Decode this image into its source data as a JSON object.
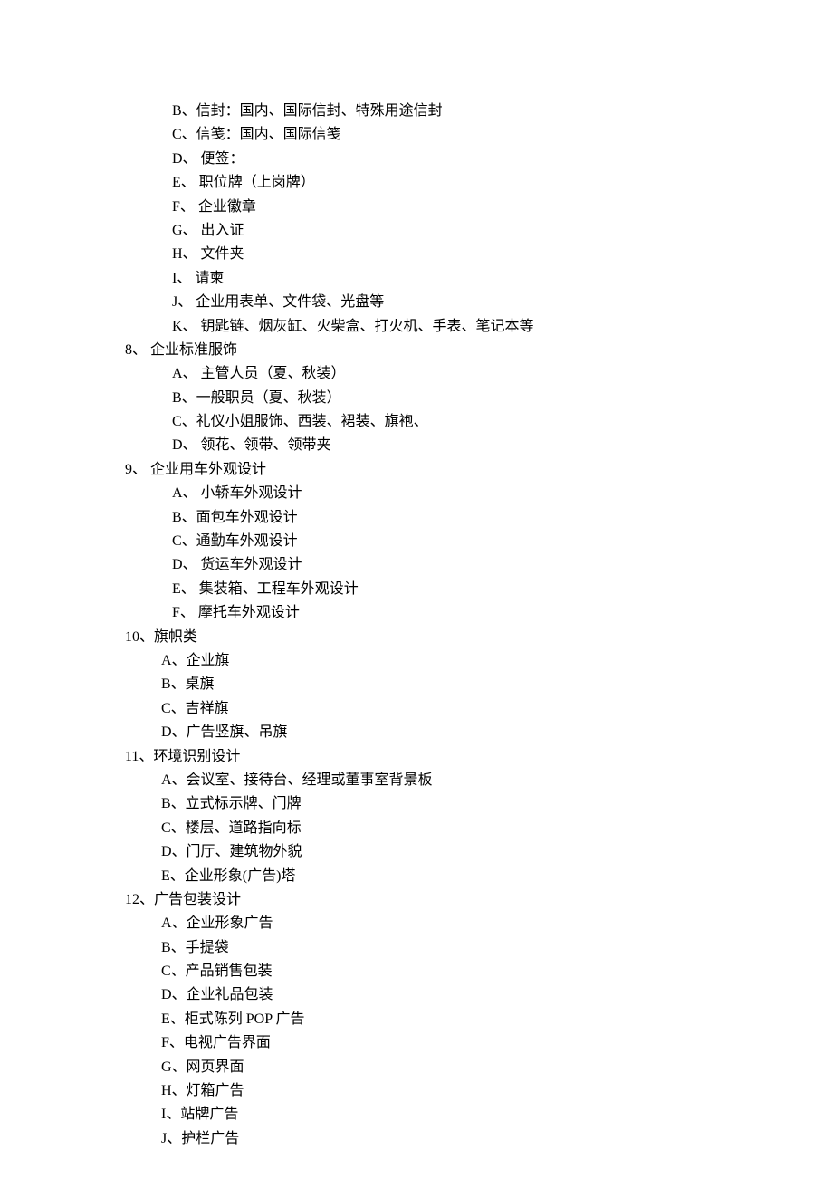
{
  "items": [
    {
      "class": "sub-item",
      "text": "B、信封：国内、国际信封、特殊用途信封"
    },
    {
      "class": "sub-item",
      "text": "C、信笺：国内、国际信笺"
    },
    {
      "class": "sub-item",
      "text": "D、 便签："
    },
    {
      "class": "sub-item",
      "text": "E、 职位牌（上岗牌）"
    },
    {
      "class": "sub-item",
      "text": "F、 企业徽章"
    },
    {
      "class": "sub-item",
      "text": "G、 出入证"
    },
    {
      "class": "sub-item",
      "text": "H、 文件夹"
    },
    {
      "class": "sub-item",
      "text": "I、 请柬"
    },
    {
      "class": "sub-item",
      "text": "J、 企业用表单、文件袋、光盘等"
    },
    {
      "class": "sub-item",
      "text": "K、 钥匙链、烟灰缸、火柴盒、打火机、手表、笔记本等"
    },
    {
      "class": "section-header",
      "text": "8、 企业标准服饰"
    },
    {
      "class": "sub-item",
      "text": "A、 主管人员（夏、秋装）"
    },
    {
      "class": "sub-item",
      "text": "B、一般职员（夏、秋装）"
    },
    {
      "class": "sub-item",
      "text": "C、礼仪小姐服饰、西装、裙装、旗袍、"
    },
    {
      "class": "sub-item",
      "text": "D、 领花、领带、领带夹"
    },
    {
      "class": "section-header",
      "text": "9、 企业用车外观设计"
    },
    {
      "class": "sub-item",
      "text": "A、 小轿车外观设计"
    },
    {
      "class": "sub-item",
      "text": "B、面包车外观设计"
    },
    {
      "class": "sub-item",
      "text": "C、通勤车外观设计"
    },
    {
      "class": "sub-item",
      "text": "D、 货运车外观设计"
    },
    {
      "class": "sub-item",
      "text": "E、 集装箱、工程车外观设计"
    },
    {
      "class": "sub-item",
      "text": "F、 摩托车外观设计"
    },
    {
      "class": "section-10-11-12",
      "text": "10、旗帜类"
    },
    {
      "class": "sub-item-10",
      "text": "A、企业旗"
    },
    {
      "class": "sub-item-10",
      "text": "B、桌旗"
    },
    {
      "class": "sub-item-10",
      "text": "C、吉祥旗"
    },
    {
      "class": "sub-item-10",
      "text": "D、广告竖旗、吊旗"
    },
    {
      "class": "section-10-11-12",
      "text": "11、环境识别设计"
    },
    {
      "class": "sub-item-10",
      "text": "A、会议室、接待台、经理或董事室背景板"
    },
    {
      "class": "sub-item-10",
      "text": "B、立式标示牌、门牌"
    },
    {
      "class": "sub-item-10",
      "text": "C、楼层、道路指向标"
    },
    {
      "class": "sub-item-10",
      "text": "D、门厅、建筑物外貌"
    },
    {
      "class": "sub-item-10",
      "text": "E、企业形象(广告)塔"
    },
    {
      "class": "section-10-11-12",
      "text": "12、广告包装设计"
    },
    {
      "class": "sub-item-10",
      "text": "A、企业形象广告"
    },
    {
      "class": "sub-item-10",
      "text": "B、手提袋"
    },
    {
      "class": "sub-item-10",
      "text": "C、产品销售包装"
    },
    {
      "class": "sub-item-10",
      "text": "D、企业礼品包装"
    },
    {
      "class": "sub-item-10",
      "text": "E、柜式陈列 POP 广告"
    },
    {
      "class": "sub-item-10",
      "text": "F、电视广告界面"
    },
    {
      "class": "sub-item-10",
      "text": "G、网页界面"
    },
    {
      "class": "sub-item-10",
      "text": "H、灯箱广告"
    },
    {
      "class": "sub-item-10",
      "text": "I、站牌广告"
    },
    {
      "class": "sub-item-10",
      "text": "J、护栏广告"
    }
  ]
}
